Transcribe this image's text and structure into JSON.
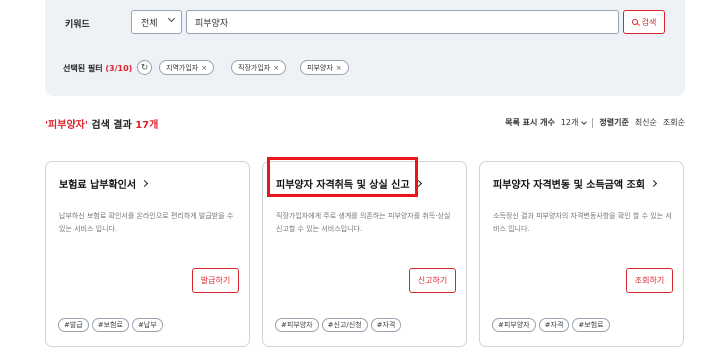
{
  "search": {
    "keyword_label": "키워드",
    "category_selected": "전체",
    "keyword_value": "피부양자",
    "search_button": "검색"
  },
  "filters": {
    "label_prefix": "선택된 필터",
    "count": "(3/10)",
    "chips": [
      {
        "label": "지역가입자"
      },
      {
        "label": "직장가입자"
      },
      {
        "label": "피부양자"
      }
    ]
  },
  "results": {
    "query_quoted": "'피부양자'",
    "text_mid": " 검색 결과 ",
    "count_text": "17개",
    "list_count_label": "목록 표시 개수",
    "list_count_value": "12개",
    "sort_label": "정렬기준",
    "sort_latest": "최신순",
    "sort_views": "조회순"
  },
  "cards": [
    {
      "title": "보험료 납부확인서",
      "desc": "납부하신 보험료 확인서를 온라인으로 편리하게 발급받을 수 있는 서비스 입니다.",
      "button": "발급하기",
      "tags": [
        "#발급",
        "#보험료",
        "#납부"
      ]
    },
    {
      "title": "피부양자 자격취득 및 상실 신고",
      "desc": "직장가입자에게 주로 생계를 의존하는 피부양자를 취득·상실 신고할 수 있는 서비스입니다.",
      "button": "신고하기",
      "tags": [
        "#피부양자",
        "#신고/신청",
        "#자격"
      ]
    },
    {
      "title": "피부양자 자격변동 및 소득금액 조회",
      "desc": "소득정신 결과 피부양자의 자격변동사항을 확인 할 수 있는 서비스 입니다.",
      "button": "조회하기",
      "tags": [
        "#피부양자",
        "#자격",
        "#보험료"
      ]
    }
  ],
  "colors": {
    "accent": "#d9262e",
    "panel_bg": "#eef1f6",
    "highlight": "#e8151b"
  }
}
